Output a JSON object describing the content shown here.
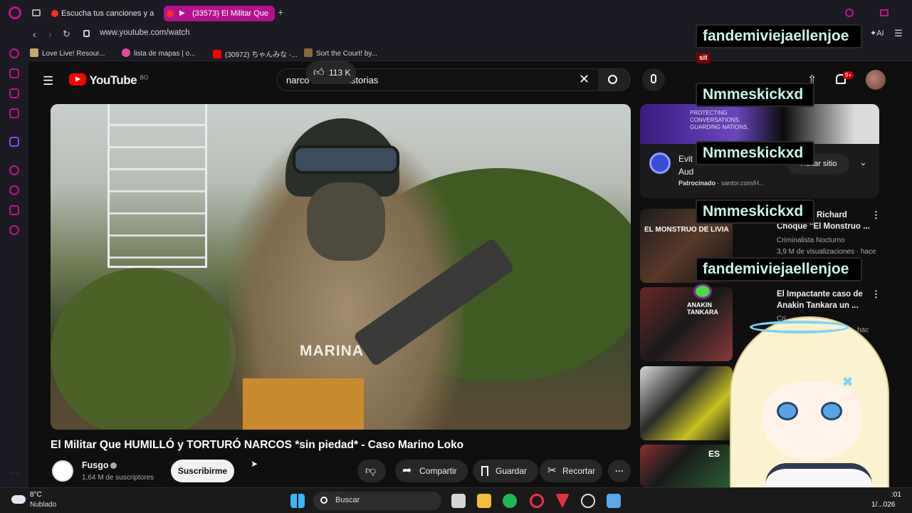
{
  "browser": {
    "tabs": [
      {
        "label": "Escucha tus canciones y a"
      },
      {
        "label": "(33573) El Militar Que"
      }
    ],
    "url": "www.youtube.com/watch",
    "ai_label": "AI",
    "bookmarks": [
      {
        "label": "Love Live! Resour..."
      },
      {
        "label": "lista de mapas | o..."
      },
      {
        "label": "(30972) ちゃんみな -..."
      },
      {
        "label": "Sort the Court! by..."
      }
    ]
  },
  "youtube": {
    "logo_text": "YouTube",
    "country_code": "BO",
    "search_value": "narco mexico historias",
    "notification_count": "9+",
    "video": {
      "title": "El Militar Que HUMILLÓ y TORTURÓ NARCOS *sin piedad* - Caso Marino Loko",
      "uniform_text": "MARINA",
      "channel_name": "Fusgo",
      "subscribers": "1,64 M de suscriptores",
      "subscribe_label": "Suscribirme",
      "likes": "113 K",
      "share_label": "Compartir",
      "save_label": "Guardar",
      "clip_label": "Recortar"
    },
    "ad": {
      "banner_text": "PROTECTING CONVERSATIONS. GUARDING NATIONS.",
      "title": "Evit",
      "subtitle": "Aud",
      "sponsored": "Patrocinado",
      "domain": "· santor.com/H...",
      "visit_label": "Visitar sitio"
    },
    "suggestions": [
      {
        "thumb_text": "EL MONSTRUO DE LIVIA",
        "title_line1": "Richard",
        "title_line2": "Choque \"El Monstruo ...",
        "channel": "Criminalista Nocturno",
        "meta": "3,9 M de visualizaciones · hace"
      },
      {
        "thumb_text": "ANAKIN TANKARA",
        "title_line1": "El Impactante caso de",
        "title_line2": "Anakin Tankara un ...",
        "channel": "Cri",
        "meta": "hac"
      },
      {
        "thumb_text": "",
        "title_line1": "",
        "title_line2": "",
        "channel": "",
        "meta": ""
      },
      {
        "thumb_text": "ES",
        "title_line1": "",
        "title_line2": "",
        "channel": "",
        "meta": ""
      }
    ]
  },
  "chat_overlay": [
    {
      "user": "fandemiviejaellenjoe",
      "badge": "sit"
    },
    {
      "user": "Nmmeskickxd"
    },
    {
      "user": "Nmmeskickxd"
    },
    {
      "user": "Nmmeskickxd"
    },
    {
      "user": "fandemiviejaellenjoe"
    }
  ],
  "taskbar": {
    "weather_temp": "8°C",
    "weather_desc": "Nublado",
    "search_label": "Buscar",
    "time": ":01",
    "date": "1/...026"
  },
  "colors": {
    "accent": "#b4128c",
    "youtube_red": "#ff0000",
    "chat_text": "#c8f4e6"
  }
}
